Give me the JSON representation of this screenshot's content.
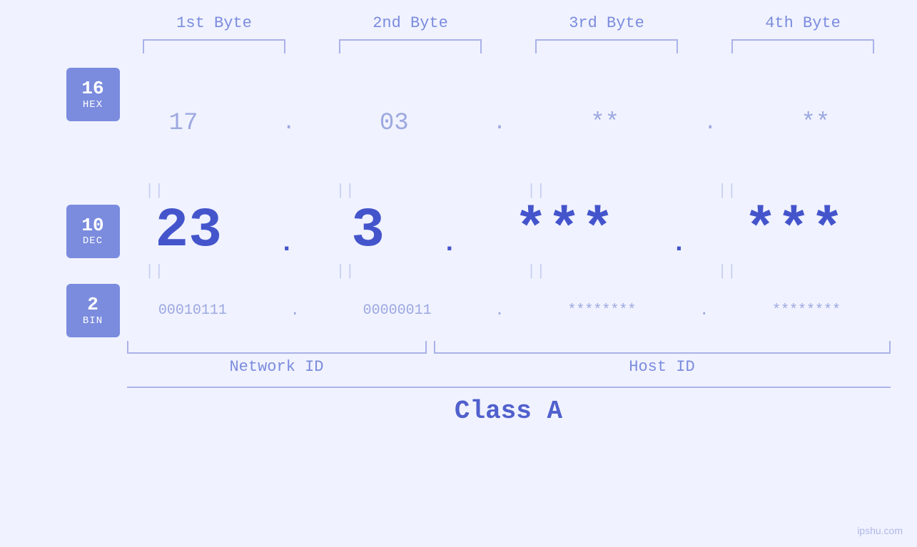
{
  "headers": {
    "byte1": "1st Byte",
    "byte2": "2nd Byte",
    "byte3": "3rd Byte",
    "byte4": "4th Byte"
  },
  "bases": {
    "hex": {
      "num": "16",
      "label": "HEX"
    },
    "dec": {
      "num": "10",
      "label": "DEC"
    },
    "bin": {
      "num": "2",
      "label": "BIN"
    }
  },
  "values": {
    "hex": {
      "b1": "17",
      "b2": "03",
      "b3": "**",
      "b4": "**",
      "d1": ".",
      "d2": ".",
      "d3": ".",
      "d4": "."
    },
    "dec": {
      "b1": "23",
      "b2": "3",
      "b3": "***",
      "b4": "***",
      "d1": ".",
      "d2": ".",
      "d3": ".",
      "d4": "."
    },
    "bin": {
      "b1": "00010111",
      "b2": "00000011",
      "b3": "********",
      "b4": "********",
      "d1": ".",
      "d2": ".",
      "d3": ".",
      "d4": "."
    }
  },
  "labels": {
    "network_id": "Network ID",
    "host_id": "Host ID",
    "class": "Class A"
  },
  "watermark": "ipshu.com",
  "equals_sign": "||"
}
